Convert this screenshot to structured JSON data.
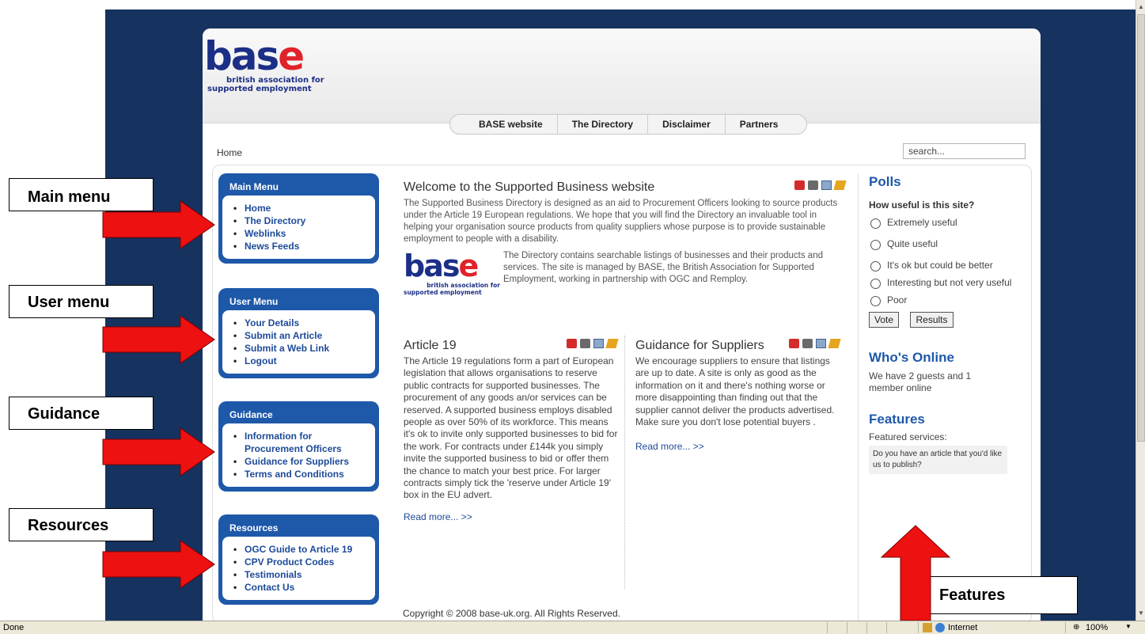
{
  "header": {
    "logo_word": "base",
    "logo_tag_1": "british association for",
    "logo_tag_2": "supported employment"
  },
  "topnav": [
    "BASE website",
    "The Directory",
    "Disclaimer",
    "Partners"
  ],
  "breadcrumb": "Home",
  "search_value": "search...",
  "menus": {
    "main": {
      "title": "Main Menu",
      "items": [
        "Home",
        "The Directory",
        "Weblinks",
        "News Feeds"
      ]
    },
    "user": {
      "title": "User Menu",
      "items": [
        "Your Details",
        "Submit an Article",
        "Submit a Web Link",
        "Logout"
      ]
    },
    "guidance": {
      "title": "Guidance",
      "items": [
        "Information for Procurement Officers",
        "Guidance for Suppliers",
        "Terms and Conditions"
      ]
    },
    "resources": {
      "title": "Resources",
      "items": [
        "OGC Guide to Article 19",
        "CPV Product Codes",
        "Testimonials",
        "Contact Us"
      ]
    }
  },
  "welcome": {
    "title": "Welcome to the Supported Business website",
    "para1": "The Supported Business Directory is designed as an aid to Procurement Officers looking to source products under the Article 19 European regulations. We hope that you will find the Directory an invaluable tool in helping your organisation source products from quality suppliers whose purpose is to provide sustainable employment to people with a disability.",
    "para2": "The Directory contains searchable listings of businesses and their products and services. The site is managed by BASE, the British Association for Supported Employment, working in partnership with OGC and Remploy."
  },
  "article19": {
    "title": "Article 19",
    "body": "The Article 19 regulations form a part of European legislation that allows organisations to reserve public contracts for supported businesses. The procurement of any goods an/or services can be reserved. A supported business employs disabled people as over 50% of its workforce. This means it's ok to invite only supported businesses to bid for the work. For contracts under £144k you simply invite the supported business to bid or offer them the chance to match your best price. For larger contracts simply tick the 'reserve under Article 19' box in the EU advert.",
    "read_more": "Read more... >>"
  },
  "guidance_suppliers": {
    "title": "Guidance for Suppliers",
    "body": "We encourage suppliers to ensure that listings are up to date. A site is only as good as the information on it and there's nothing worse or more disappointing than finding out that the supplier cannot deliver the products advertised. Make sure you don't lose potential buyers .",
    "read_more": "Read more... >>"
  },
  "copyright": "Copyright © 2008 base-uk.org. All Rights Reserved.",
  "polls": {
    "title": "Polls",
    "question": "How useful is this site?",
    "options": [
      "Extremely useful",
      "Quite useful",
      "It's ok but could be better",
      "Interesting but not very useful",
      "Poor"
    ],
    "vote": "Vote",
    "results": "Results"
  },
  "online": {
    "title": "Who's Online",
    "text": "We have 2 guests and 1 member online"
  },
  "features": {
    "title": "Features",
    "sub": "Featured services:",
    "box": "Do you have an article that you'd like us to publish?"
  },
  "annotations": [
    "Main menu",
    "User menu",
    "Guidance",
    "Resources",
    "Features"
  ],
  "statusbar": {
    "left": "Done",
    "zone": "Internet",
    "zoom": "100%"
  },
  "colors": {
    "background": "#16325f",
    "menu_blue": "#1e58a9",
    "arrow_red": "#ee1111",
    "logo_blue": "#1c2f87",
    "logo_red": "#e0222a"
  }
}
